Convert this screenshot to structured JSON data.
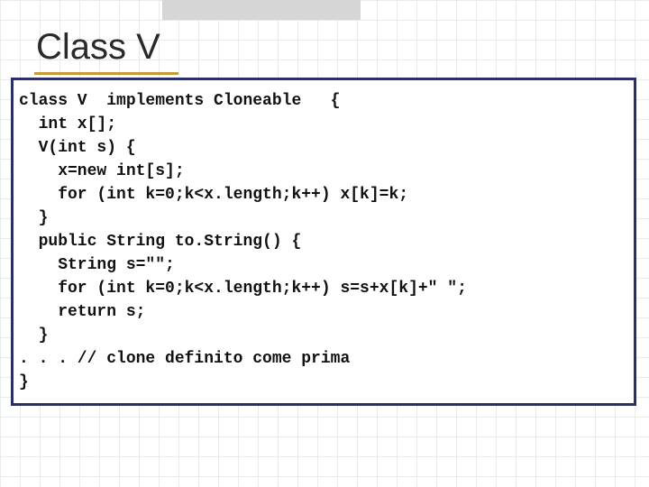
{
  "slide": {
    "title": "Class V",
    "code_lines": [
      "class V  implements Cloneable   {",
      "  int x[];",
      "  V(int s) {",
      "    x=new int[s];",
      "    for (int k=0;k<x.length;k++) x[k]=k;",
      "  }",
      "  public String to.String() {",
      "    String s=\"\";",
      "    for (int k=0;k<x.length;k++) s=s+x[k]+\" \";",
      "    return s;",
      "  }",
      ". . . // clone definito come prima",
      "}"
    ]
  }
}
